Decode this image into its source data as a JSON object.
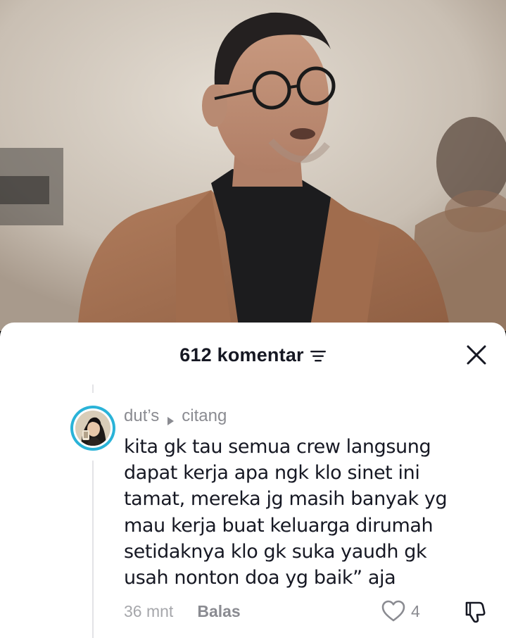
{
  "header": {
    "title": "612 komentar",
    "sort_icon": "sort-lines-icon",
    "close_icon": "close-icon"
  },
  "comment": {
    "username": "dut’s",
    "reply_to": "citang",
    "text_lines": [
      "kita gk tau semua crew langsung",
      "dapat kerja apa ngk klo sinet ini",
      "tamat, mereka jg masih banyak yg",
      "mau kerja buat keluarga dirumah",
      "setidaknya klo gk suka yaudh gk",
      "usah nonton doa yg baik” aja"
    ],
    "time": "36 mnt",
    "reply_label": "Balas",
    "like_count": "4"
  },
  "colors": {
    "avatar_ring": "#2ab3d8",
    "text_primary": "#161823",
    "text_secondary": "#8a8b91"
  }
}
